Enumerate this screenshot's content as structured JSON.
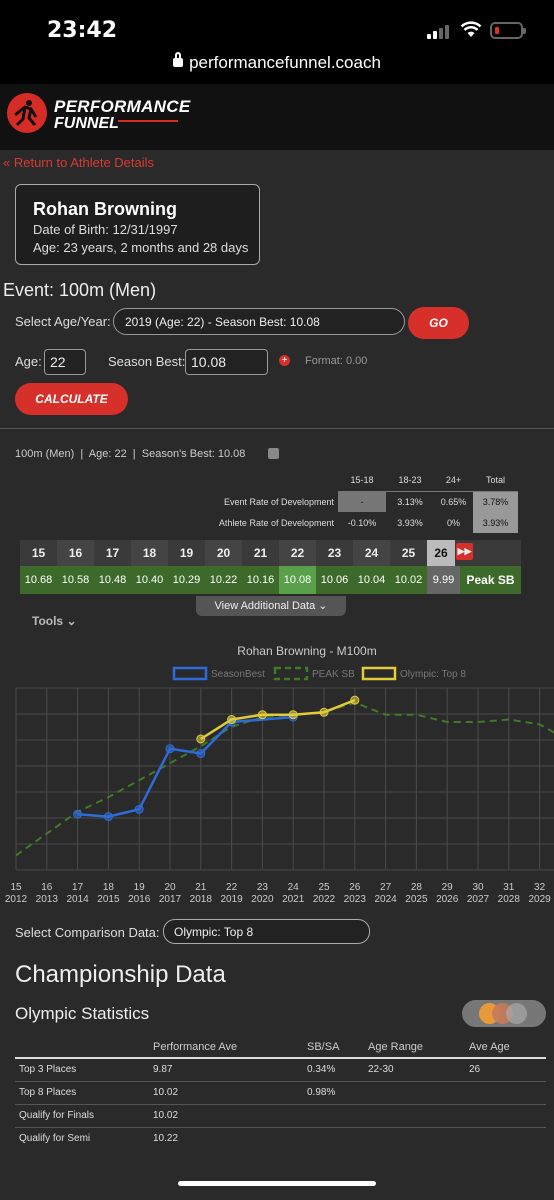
{
  "status_bar": {
    "time": "23:42",
    "url": "performancefunnel.coach"
  },
  "brand": {
    "line1": "PERFORMANCE",
    "line2": "FUNNEL"
  },
  "nav": {
    "back_link": "« Return to Athlete Details"
  },
  "athlete": {
    "name": "Rohan Browning",
    "dob": "Date of Birth: 12/31/1997",
    "age": "Age: 23 years, 2 months and 28 days"
  },
  "event": {
    "title": "Event: 100m (Men)"
  },
  "age_year_select": {
    "label": "Select Age/Year:",
    "value": "2019 (Age: 22) - Season Best: 10.08",
    "go_label": "GO"
  },
  "calc_form": {
    "age_label": "Age:",
    "age_value": "22",
    "sb_label": "Season Best:",
    "sb_value": "10.08",
    "format_hint": "Format: 0.00",
    "calculate_label": "CALCULATE"
  },
  "summary": {
    "text": "100m (Men)  |  Age: 22  |  Season's Best: 10.08"
  },
  "rates": {
    "headers": [
      "15-18",
      "18-23",
      "24+",
      "Total"
    ],
    "rows": [
      {
        "label": "Event Rate of Development",
        "values": [
          "-",
          "3.13%",
          "0.65%",
          "3.78%"
        ]
      },
      {
        "label": "Athlete Rate of Development",
        "values": [
          "-0.10%",
          "3.93%",
          "0%",
          "3.93%"
        ]
      }
    ]
  },
  "ages_table": {
    "ages": [
      "15",
      "16",
      "17",
      "18",
      "19",
      "20",
      "21",
      "22",
      "23",
      "24",
      "25",
      "26"
    ],
    "values": [
      "10.68",
      "10.58",
      "10.48",
      "10.40",
      "10.29",
      "10.22",
      "10.16",
      "10.08",
      "10.06",
      "10.04",
      "10.02",
      "9.99"
    ],
    "peak_label": "Peak SB",
    "selected": "22",
    "view_more_label": "View Additional Data",
    "tools_label": "Tools"
  },
  "chart_data": {
    "type": "line",
    "title": "Rohan Browning - M100m",
    "legend": [
      "SeasonBest",
      "PEAK SB",
      "Olympic: Top 8"
    ],
    "x_ages": [
      "15",
      "16",
      "17",
      "18",
      "19",
      "20",
      "21",
      "22",
      "23",
      "24",
      "25",
      "26",
      "27",
      "28",
      "29",
      "30",
      "31",
      "32"
    ],
    "x_years": [
      "2012",
      "2013",
      "2014",
      "2015",
      "2016",
      "2017",
      "2018",
      "2019",
      "2020",
      "2021",
      "2022",
      "2023",
      "2024",
      "2025",
      "2026",
      "2027",
      "2028",
      "2029"
    ],
    "series": [
      {
        "name": "SeasonBest",
        "color": "#2f6bd8",
        "dashed": false,
        "points": [
          [
            17,
            10.57
          ],
          [
            18,
            10.58
          ],
          [
            19,
            10.55
          ],
          [
            20,
            10.3
          ],
          [
            21,
            10.32
          ],
          [
            22,
            10.19
          ],
          [
            24,
            10.17
          ]
        ]
      },
      {
        "name": "PEAK SB",
        "color": "#3f7a28",
        "dashed": true,
        "points": [
          [
            15,
            10.74
          ],
          [
            16,
            10.65
          ],
          [
            17,
            10.56
          ],
          [
            18,
            10.5
          ],
          [
            19,
            10.43
          ],
          [
            20,
            10.36
          ],
          [
            21,
            10.29
          ],
          [
            22,
            10.21
          ],
          [
            23,
            10.17
          ],
          [
            24,
            10.16
          ],
          [
            25,
            10.15
          ],
          [
            26,
            10.11
          ],
          [
            27,
            10.16
          ],
          [
            28,
            10.16
          ],
          [
            29,
            10.19
          ],
          [
            30,
            10.19
          ],
          [
            31,
            10.18
          ],
          [
            32,
            10.2
          ],
          [
            33,
            10.27
          ]
        ]
      },
      {
        "name": "Olympic: Top 8",
        "color": "#e2cc3a",
        "dashed": false,
        "points": [
          [
            21,
            10.26
          ],
          [
            22,
            10.18
          ],
          [
            23,
            10.16
          ],
          [
            24,
            10.16
          ],
          [
            25,
            10.15
          ],
          [
            26,
            10.1
          ]
        ]
      }
    ]
  },
  "comparison": {
    "label": "Select Comparison Data:",
    "value": "Olympic: Top 8"
  },
  "championship": {
    "title": "Championship Data",
    "subtitle": "Olympic Statistics",
    "headers": [
      "",
      "Performance Ave",
      "SB/SA",
      "Age Range",
      "Ave Age"
    ],
    "rows": [
      [
        "Top 3 Places",
        "9.87",
        "0.34%",
        "22-30",
        "26"
      ],
      [
        "Top 8 Places",
        "10.02",
        "0.98%",
        "",
        ""
      ],
      [
        "Qualify for Finals",
        "10.02",
        "",
        "",
        ""
      ],
      [
        "Qualify for Semi",
        "10.22",
        "",
        "",
        ""
      ]
    ]
  }
}
